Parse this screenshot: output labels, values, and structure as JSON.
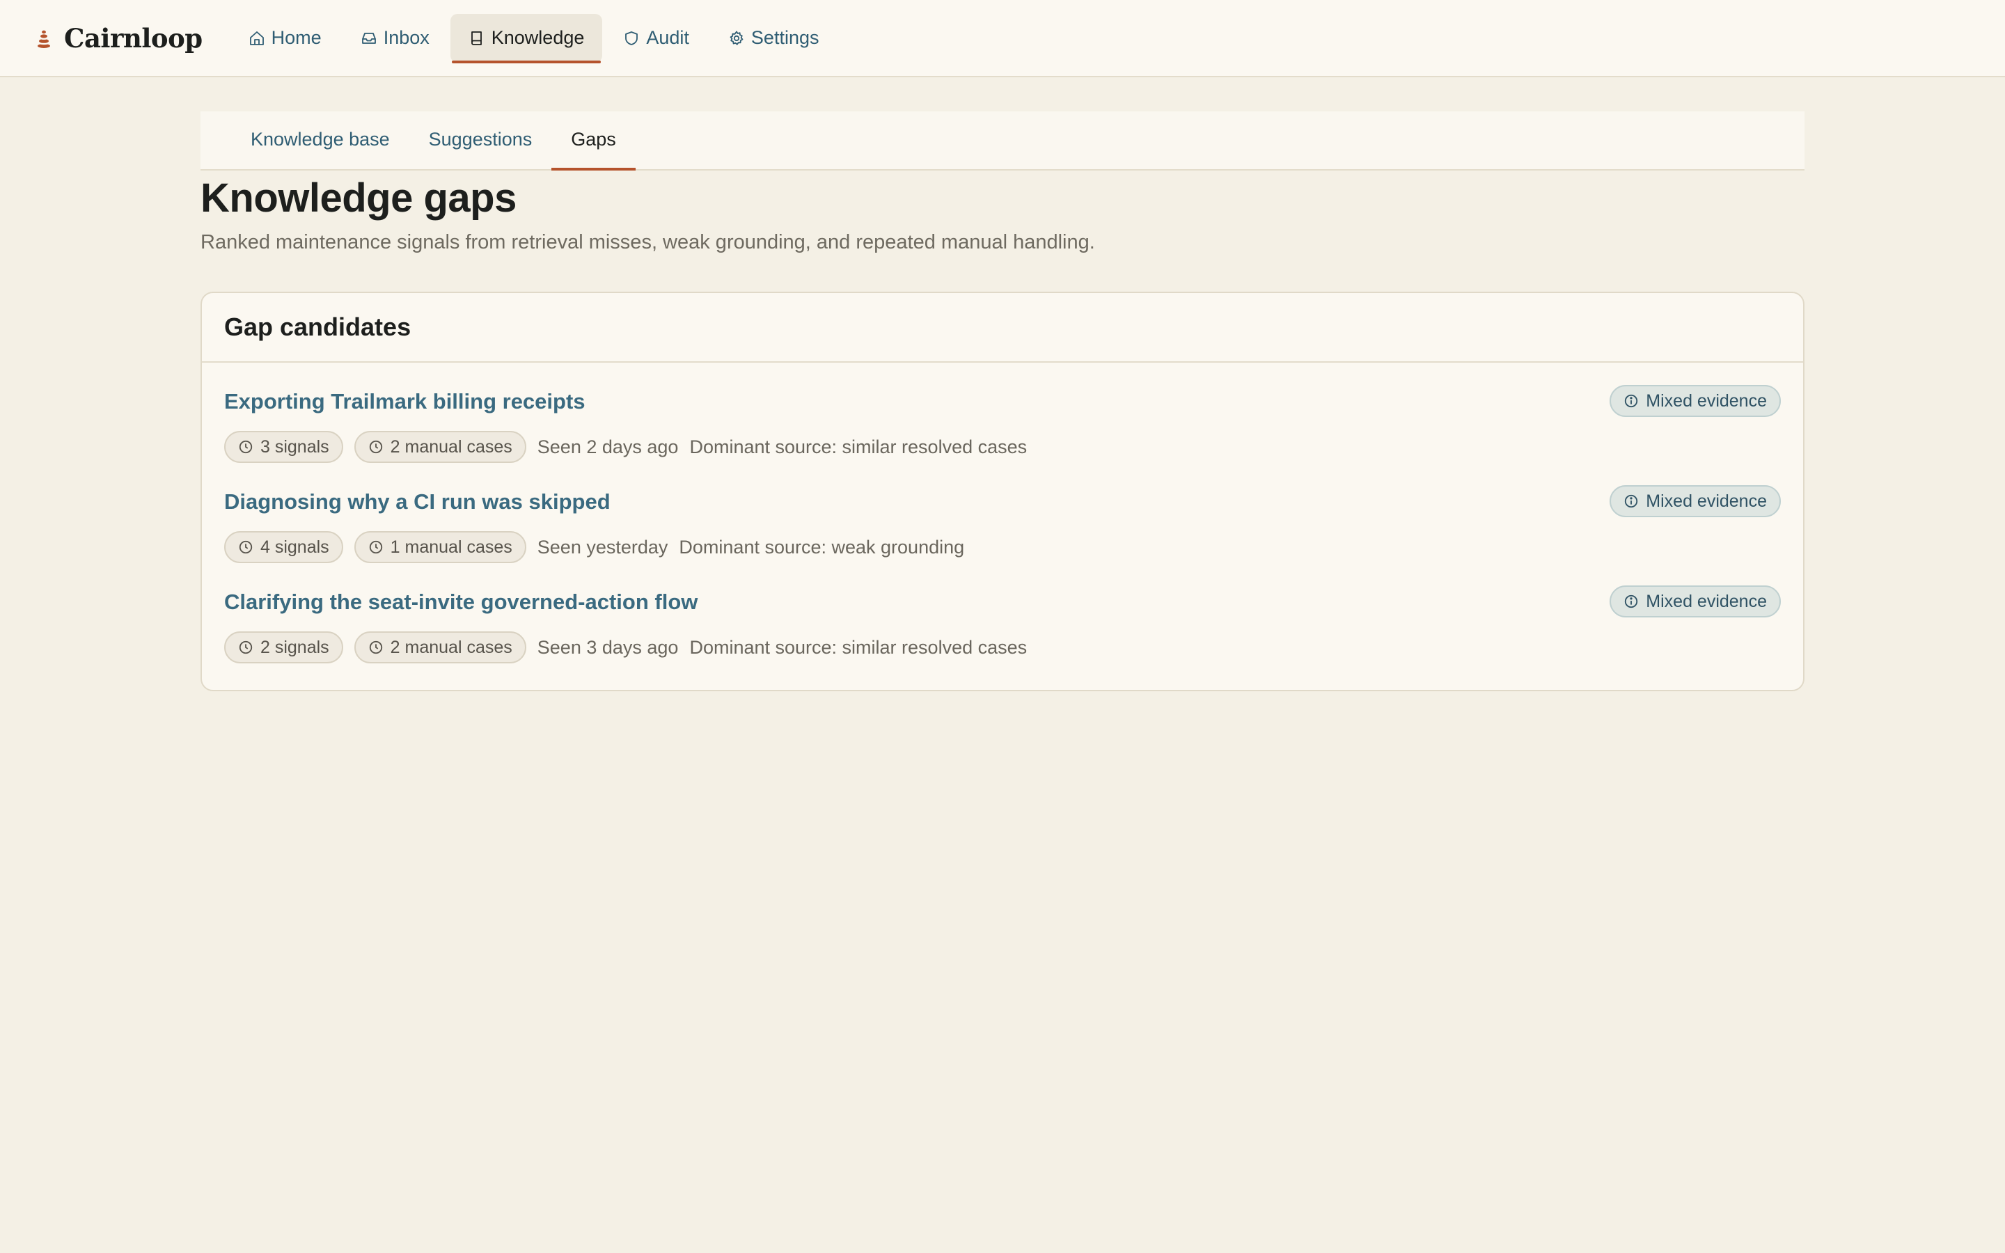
{
  "brand": {
    "name": "Cairnloop"
  },
  "nav": {
    "items": [
      {
        "label": "Home",
        "icon": "home-icon"
      },
      {
        "label": "Inbox",
        "icon": "inbox-icon"
      },
      {
        "label": "Knowledge",
        "icon": "book-icon",
        "active": true
      },
      {
        "label": "Audit",
        "icon": "shield-icon"
      },
      {
        "label": "Settings",
        "icon": "gear-icon"
      }
    ]
  },
  "subtabs": {
    "items": [
      {
        "label": "Knowledge base"
      },
      {
        "label": "Suggestions"
      },
      {
        "label": "Gaps",
        "active": true
      }
    ]
  },
  "page": {
    "title": "Knowledge gaps",
    "subtitle": "Ranked maintenance signals from retrieval misses, weak grounding, and repeated manual handling."
  },
  "card": {
    "title": "Gap candidates",
    "rows": [
      {
        "title": "Exporting Trailmark billing receipts",
        "signals": "3 signals",
        "manual": "2 manual cases",
        "seen": "Seen 2 days ago",
        "source": "Dominant source: similar resolved cases",
        "badge": "Mixed evidence"
      },
      {
        "title": "Diagnosing why a CI run was skipped",
        "signals": "4 signals",
        "manual": "1 manual cases",
        "seen": "Seen yesterday",
        "source": "Dominant source: weak grounding",
        "badge": "Mixed evidence"
      },
      {
        "title": "Clarifying the seat-invite governed-action flow",
        "signals": "2 signals",
        "manual": "2 manual cases",
        "seen": "Seen 3 days ago",
        "source": "Dominant source: similar resolved cases",
        "badge": "Mixed evidence"
      }
    ]
  },
  "colors": {
    "accent": "#b5532c",
    "link": "#2f5d73",
    "background": "#f4f0e5"
  }
}
